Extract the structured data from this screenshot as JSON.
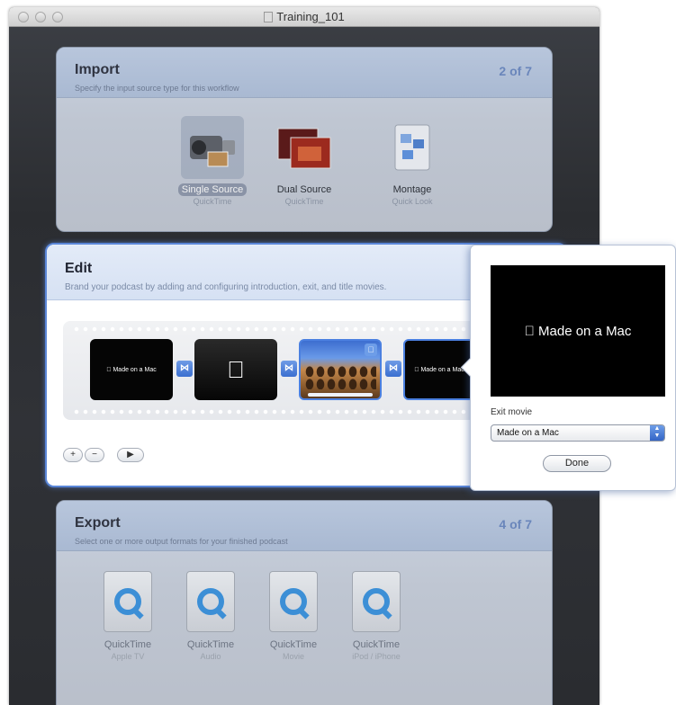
{
  "window": {
    "title": "Training_101"
  },
  "import_panel": {
    "title": "Import",
    "subtitle": "Specify the input source type for this workflow",
    "step": "2 of 7",
    "items": [
      {
        "label": "Single Source",
        "sublabel": "QuickTime",
        "icon": "camcorder-icon",
        "selected": true
      },
      {
        "label": "Dual Source",
        "sublabel": "QuickTime",
        "icon": "dual-screens-icon",
        "selected": false
      },
      {
        "label": "Montage",
        "sublabel": "Quick Look",
        "icon": "montage-icon",
        "selected": false
      }
    ]
  },
  "edit_panel": {
    "title": "Edit",
    "subtitle": "Brand your podcast by adding and configuring introduction, exit, and title movies.",
    "clips": [
      {
        "text": "Made on a Mac"
      },
      {
        "text": ""
      },
      {
        "text": ""
      },
      {
        "text": "Made on a Mac"
      }
    ],
    "controls": {
      "add": "+",
      "remove": "−",
      "play": "▶"
    }
  },
  "export_panel": {
    "title": "Export",
    "subtitle": "Select one or more output formats for your finished podcast",
    "step": "4 of 7",
    "items": [
      {
        "label": "QuickTime",
        "sublabel": "Apple TV"
      },
      {
        "label": "QuickTime",
        "sublabel": "Audio"
      },
      {
        "label": "QuickTime",
        "sublabel": "Movie"
      },
      {
        "label": "QuickTime",
        "sublabel": "iPod / iPhone"
      }
    ]
  },
  "popover": {
    "preview_text": "Made on a Mac",
    "field_label": "Exit movie",
    "selected_option": "Made on a Mac",
    "done_label": "Done"
  },
  "colors": {
    "accent": "#5a86d8",
    "quicktime": "#3c8fd6"
  }
}
